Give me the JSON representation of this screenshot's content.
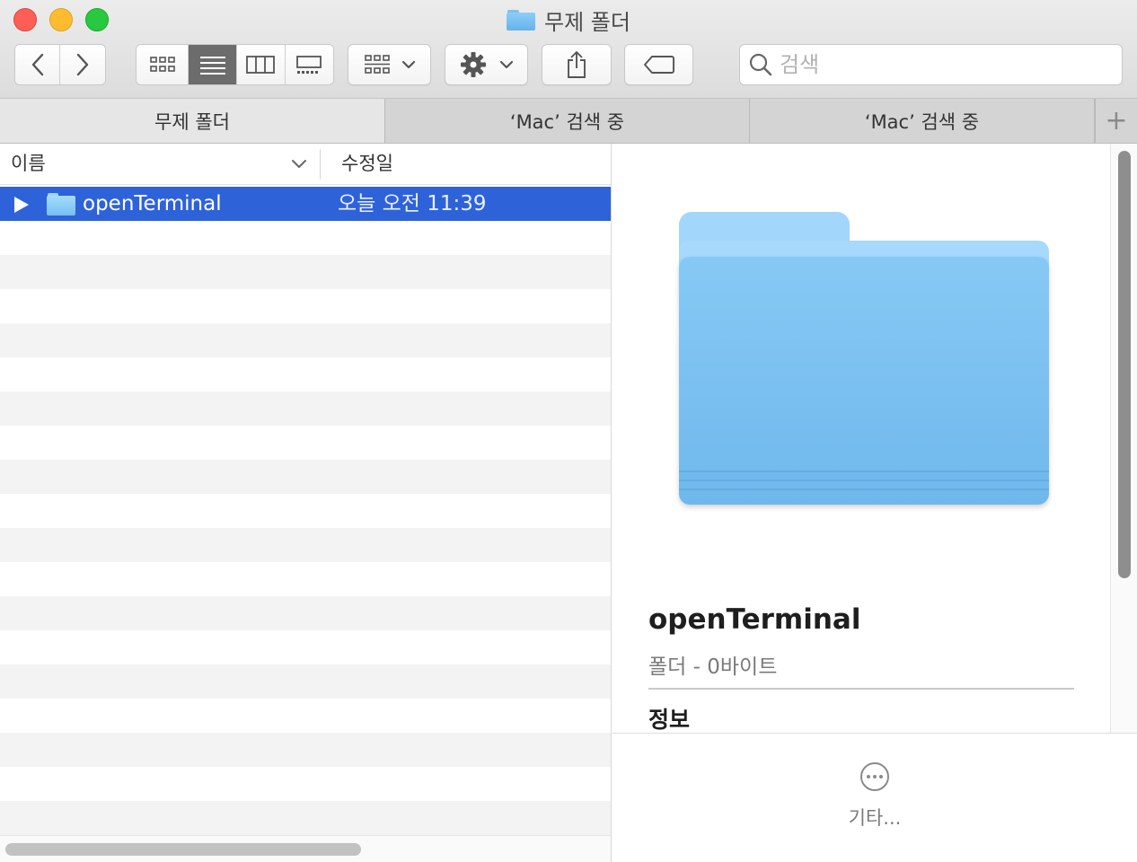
{
  "window": {
    "title": "무제 폴더"
  },
  "toolbar": {
    "back_icon": "chevron-left-icon",
    "forward_icon": "chevron-right-icon",
    "view_modes": [
      "icon-view",
      "list-view",
      "column-view",
      "gallery-view"
    ],
    "active_view": "list-view",
    "group_icon": "group-by-icon",
    "action_icon": "gear-icon",
    "share_icon": "share-icon",
    "tag_icon": "tag-icon"
  },
  "search": {
    "placeholder": "검색",
    "value": ""
  },
  "tabs": [
    {
      "label": "무제 폴더",
      "active": true
    },
    {
      "label": "‘Mac’ 검색 중",
      "active": false
    },
    {
      "label": "‘Mac’ 검색 중",
      "active": false
    }
  ],
  "tab_add_label": "+",
  "list": {
    "columns": {
      "name": "이름",
      "modified": "수정일"
    },
    "items": [
      {
        "name": "openTerminal",
        "modified": "오늘 오전 11:39",
        "kind": "folder",
        "selected": true
      }
    ]
  },
  "preview": {
    "name": "openTerminal",
    "subtitle": "폴더 - 0바이트",
    "section": "정보",
    "more_label": "기타..."
  },
  "colors": {
    "selection": "#2e62d9",
    "folder": "#7cc2f3"
  }
}
